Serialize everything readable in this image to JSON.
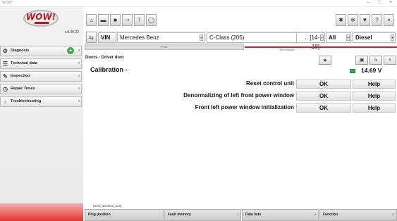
{
  "window": {
    "title": "WOW!",
    "controls": [
      "–",
      "□",
      "×"
    ]
  },
  "brand": {
    "logo_text": "WOW!",
    "version": "v.5.00.22",
    "red": "#c0141a"
  },
  "sidebar": {
    "items": [
      {
        "label": "Diagnosis",
        "icon": "car-diagnosis-icon",
        "glyph": "⚙"
      },
      {
        "label": "Technical data",
        "icon": "data-sheet-icon",
        "glyph": "☰"
      },
      {
        "label": "Inspection",
        "icon": "wrench-icon",
        "glyph": "✎"
      },
      {
        "label": "Repair Times",
        "icon": "clock-icon",
        "glyph": "◷"
      },
      {
        "label": "Troubleshooting",
        "icon": "stethoscope-icon",
        "glyph": "♁"
      }
    ],
    "add_glyph": "+"
  },
  "toolbar": {
    "buttons": [
      {
        "name": "home-icon",
        "glyph": "⌂"
      },
      {
        "name": "car-icon",
        "glyph": "▬"
      },
      {
        "name": "bus-icon",
        "glyph": "■"
      },
      {
        "name": "truck-icon",
        "glyph": "⇀"
      },
      {
        "name": "plug-icon",
        "glyph": "⊤"
      },
      {
        "name": "tire-icon",
        "glyph": "◯"
      }
    ],
    "right_buttons": [
      {
        "name": "tools-icon",
        "glyph": "✖"
      },
      {
        "name": "settings-icon",
        "glyph": "✲"
      },
      {
        "name": "trash-icon",
        "glyph": "▼"
      },
      {
        "name": "help-icon",
        "glyph": "?"
      },
      {
        "name": "close-icon",
        "glyph": "×"
      }
    ]
  },
  "vehicle": {
    "back_glyph": "⇆",
    "vin_label": "VIN",
    "make": "Mercedes Benz",
    "model": "C-Class (205)",
    "years": ".. [14-18]",
    "engine": "All",
    "fuel": "Diesel",
    "dropdown_glyph": "▾"
  },
  "strip": {
    "label": "HTML",
    "small_text": "Test Module"
  },
  "main": {
    "breadcrumb": "Doors - Driver door",
    "title": "Calibration -",
    "voltage": "14.69 V",
    "action_buttons": [
      {
        "name": "print-icon",
        "glyph": "▲"
      },
      {
        "name": "save-icon",
        "glyph": "▣"
      },
      {
        "name": "back-arrow-icon",
        "glyph": "↳"
      },
      {
        "name": "close-icon",
        "glyph": "×"
      }
    ],
    "rows": [
      {
        "label": "Reset control unit",
        "ok": "OK",
        "help": "Help"
      },
      {
        "label": "Denormalizing of left front power window",
        "ok": "OK",
        "help": "Help"
      },
      {
        "label": "Front left power window initialization",
        "ok": "OK",
        "help": "Help"
      }
    ],
    "stack_file": "[Smb_dm0222_bas]"
  },
  "bottom_tabs": [
    {
      "label": "Plug position"
    },
    {
      "label": "Fault memory"
    },
    {
      "label": "Data lists"
    },
    {
      "label": "Function"
    }
  ],
  "arrow_glyph": "›"
}
